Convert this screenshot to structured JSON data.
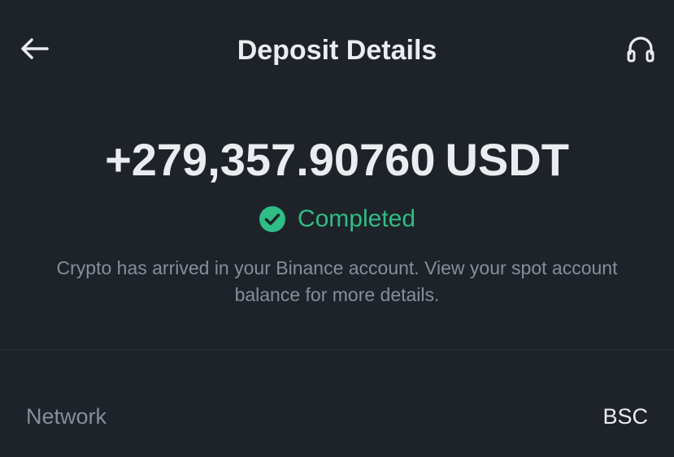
{
  "header": {
    "title": "Deposit Details",
    "back_icon": "arrow-left-icon",
    "support_icon": "headset-icon"
  },
  "deposit": {
    "amount": "+279,357.90760",
    "currency": "USDT",
    "status": "Completed",
    "status_icon": "check-circle-icon",
    "message": "Crypto has arrived in your Binance account. View your spot account balance for more details."
  },
  "details": {
    "network_label": "Network",
    "network_value": "BSC"
  },
  "colors": {
    "background": "#1e2329",
    "primary_text": "#eaecef",
    "secondary_text": "#848e9c",
    "success": "#2ebd85"
  }
}
